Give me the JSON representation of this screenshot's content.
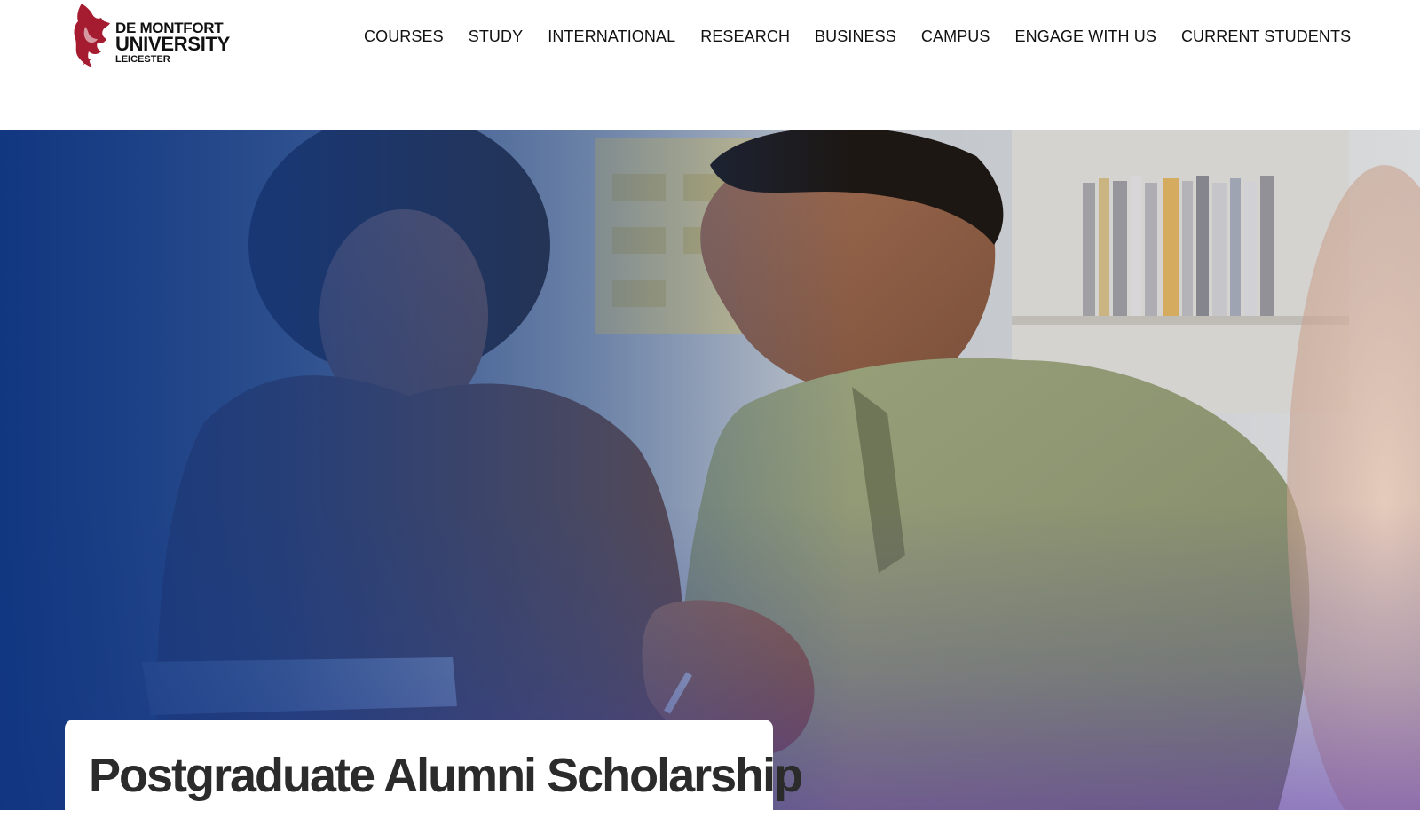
{
  "header": {
    "logo": {
      "line1": "DE MONTFORT",
      "line2": "UNIVERSITY",
      "line3": "LEICESTER",
      "brand_color": "#a51c30"
    },
    "nav": [
      {
        "label": "COURSES"
      },
      {
        "label": "STUDY"
      },
      {
        "label": "INTERNATIONAL"
      },
      {
        "label": "RESEARCH"
      },
      {
        "label": "BUSINESS"
      },
      {
        "label": "CAMPUS"
      },
      {
        "label": "ENGAGE WITH US"
      },
      {
        "label": "CURRENT STUDENTS"
      }
    ]
  },
  "hero": {
    "title": "Postgraduate Alumni Scholarship",
    "overlay_colors": [
      "#0e3480",
      "#5a32aa"
    ]
  }
}
